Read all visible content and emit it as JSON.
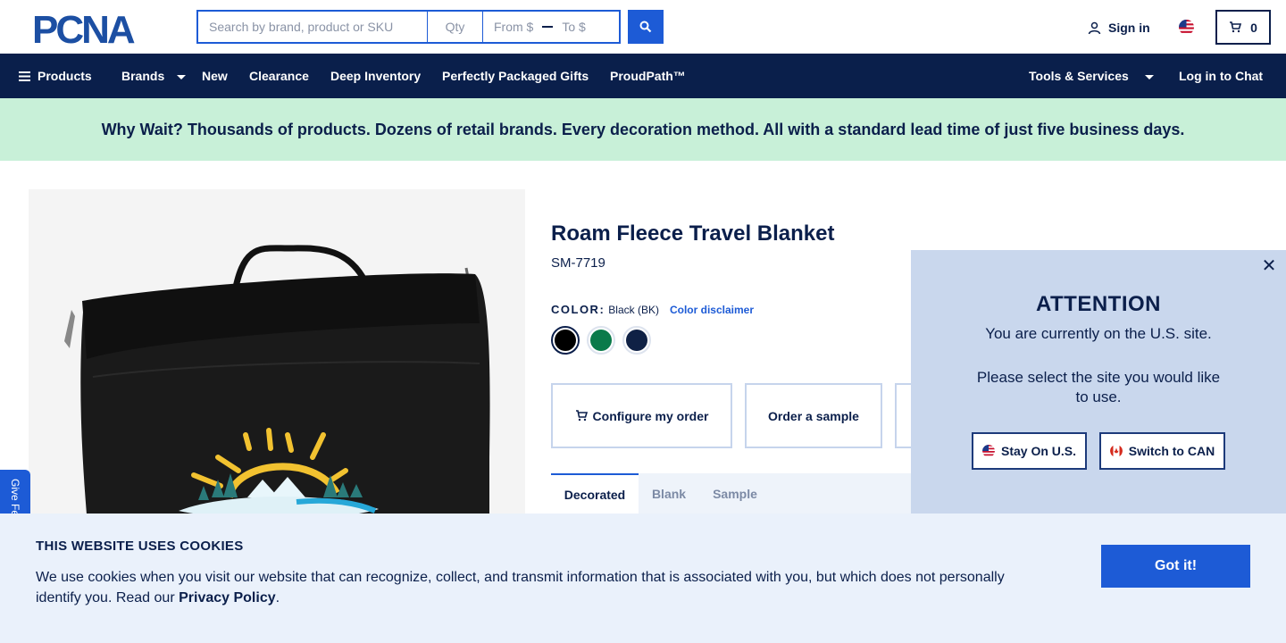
{
  "header": {
    "logo_text": "PCNA",
    "search": {
      "placeholder": "Search by brand, product or SKU",
      "qty_placeholder": "Qty",
      "from_placeholder": "From $",
      "to_placeholder": "To $",
      "submit_icon": "search-icon"
    },
    "sign_in_label": "Sign in",
    "locale_flag": "us-flag",
    "cart_count": "0"
  },
  "nav": {
    "products_label": "Products",
    "brands_label": "Brands",
    "new_label": "New",
    "clearance_label": "Clearance",
    "deep_inventory_label": "Deep Inventory",
    "gifts_label": "Perfectly Packaged Gifts",
    "proudpath_label": "ProudPath™",
    "tools_label": "Tools & Services",
    "chat_label": "Log in to Chat",
    "background_color": "#0a1f4b"
  },
  "promo": {
    "text": "Why Wait? Thousands of products. Dozens of retail brands. Every decoration method. All with a standard lead time of just five business days.",
    "background_color": "#c8f0d8"
  },
  "product": {
    "title": "Roam Fleece Travel Blanket",
    "sku": "SM-7719",
    "color_label": "COLOR:",
    "color_value": "Black (BK)",
    "color_disclaimer": "Color disclaimer",
    "swatches": [
      {
        "name": "Black",
        "color": "#000000",
        "selected": true
      },
      {
        "name": "Green",
        "color": "#0a7a4a",
        "selected": false
      },
      {
        "name": "Navy",
        "color": "#0f2145",
        "selected": false
      }
    ],
    "actions": {
      "configure_label": "Configure my order",
      "sample_label": "Order a sample"
    },
    "tabs": [
      "Decorated",
      "Blank",
      "Sample"
    ],
    "active_tab": "Decorated"
  },
  "attention_modal": {
    "heading": "ATTENTION",
    "message_current": "You are currently on the U.S. site.",
    "message_select": "Please select the site you would like to use.",
    "stay_label": "Stay On U.S.",
    "switch_label": "Switch to CAN",
    "close_icon": "close-icon"
  },
  "feedback": {
    "label": "Give Feedback"
  },
  "cookie_banner": {
    "heading": "THIS WEBSITE USES COOKIES",
    "text": "We use cookies when you visit our website that can recognize, collect, and transmit information that is associated with you, but which does not personally identify you. Read our ",
    "link_label": "Privacy Policy",
    "text_end": ".",
    "accept_label": "Got it!"
  },
  "colors": {
    "brand_navy": "#0b1f4b",
    "accent_blue": "#1d5bd6",
    "modal_bg": "#c9d7ed",
    "cookie_bg": "#eaf1fb"
  }
}
